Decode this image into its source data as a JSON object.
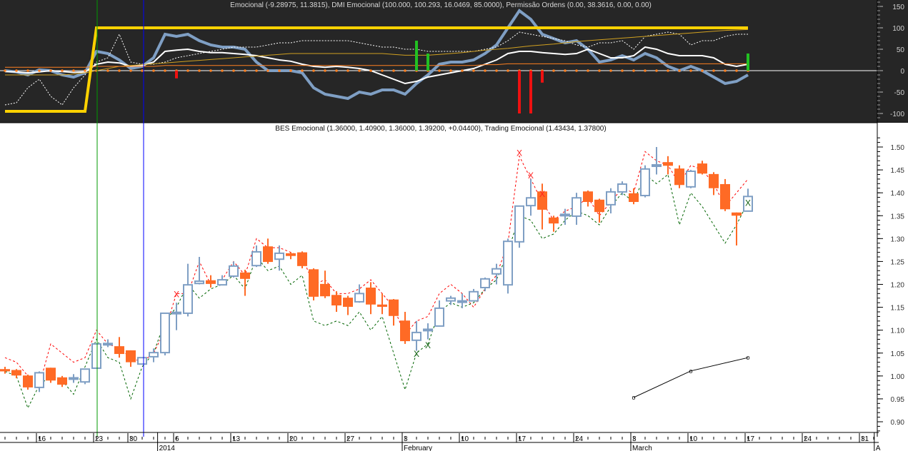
{
  "indicator_panel": {
    "title": "Emocional (-9.28975, 11.3815), DMI Emocional (100.000, 100.293, 16.0469, 85.0000), Permissão Ordens (0.00, 38.3616, 0.00, 0.00)",
    "background": "#262626",
    "y_ticks": [
      150,
      100,
      50,
      0,
      -50,
      -100
    ]
  },
  "price_panel": {
    "title": "BES Emocional (1.36000, 1.40900, 1.36000, 1.39200, +0.04400), Trading Emocional (1.43434, 1.37800)",
    "y_ticks": [
      "1.50",
      "1.45",
      "1.40",
      "1.35",
      "1.30",
      "1.25",
      "1.20",
      "1.15",
      "1.10",
      "1.05",
      "1.00",
      "0.95",
      "0.90"
    ]
  },
  "date_axis": {
    "day_labels": [
      {
        "label": "16",
        "i": 3
      },
      {
        "label": "23",
        "i": 8
      },
      {
        "label": "30",
        "i": 11
      },
      {
        "label": "6",
        "i": 15
      },
      {
        "label": "13",
        "i": 20
      },
      {
        "label": "20",
        "i": 25
      },
      {
        "label": "27",
        "i": 30
      },
      {
        "label": "3",
        "i": 35
      },
      {
        "label": "10",
        "i": 40
      },
      {
        "label": "17",
        "i": 45
      },
      {
        "label": "24",
        "i": 50
      },
      {
        "label": "3",
        "i": 55
      },
      {
        "label": "10",
        "i": 60
      },
      {
        "label": "17",
        "i": 65
      },
      {
        "label": "24",
        "i": 70
      },
      {
        "label": "31",
        "i": 75
      }
    ],
    "period_labels": [
      {
        "label": "2014",
        "i": 13.6
      },
      {
        "label": "February",
        "i": 35
      },
      {
        "label": "March",
        "i": 55
      },
      {
        "label": "A",
        "i": 76.3
      }
    ]
  },
  "colors": {
    "up": "#7f9fc4",
    "down": "#ff6a25",
    "upper_band": "#ff0000",
    "lower_band": "#006400",
    "yellow": "#ffd200",
    "emocional": "#7f9fc4",
    "buy_bar": "#22c022",
    "sell_bar": "#ee1111",
    "vline_green": "#009900",
    "vline_blue": "#0000ff"
  },
  "chart_data": [
    {
      "type": "line",
      "title": "Emocional / DMI Emocional / Permissão Ordens",
      "ylim": [
        -120,
        165
      ],
      "series": [
        {
          "name": "Emocional",
          "values": [
            0,
            -3,
            -10,
            2,
            0,
            -10,
            -15,
            -5,
            45,
            40,
            25,
            5,
            10,
            30,
            85,
            80,
            85,
            70,
            60,
            55,
            55,
            50,
            20,
            0,
            0,
            0,
            -5,
            -40,
            -55,
            -60,
            -65,
            -50,
            -55,
            -45,
            -45,
            -55,
            -30,
            -10,
            15,
            20,
            20,
            25,
            40,
            60,
            100,
            140,
            120,
            85,
            75,
            65,
            70,
            50,
            20,
            25,
            35,
            25,
            40,
            30,
            10,
            0,
            10,
            0,
            -15,
            -30,
            -25,
            -10
          ]
        },
        {
          "name": "DMI",
          "values": [
            -2,
            -3,
            -5,
            -3,
            0,
            -2,
            -4,
            -3,
            15,
            20,
            18,
            10,
            12,
            20,
            45,
            48,
            50,
            45,
            42,
            42,
            40,
            38,
            35,
            30,
            25,
            22,
            15,
            10,
            8,
            10,
            8,
            5,
            0,
            -10,
            -20,
            -30,
            -25,
            -15,
            -10,
            -5,
            0,
            5,
            15,
            25,
            40,
            45,
            45,
            42,
            40,
            38,
            40,
            50,
            40,
            30,
            30,
            35,
            55,
            50,
            40,
            35,
            35,
            35,
            30,
            15,
            10,
            15
          ]
        },
        {
          "name": "DMI dashed",
          "values": [
            -80,
            -75,
            -40,
            -20,
            -60,
            -80,
            -40,
            -10,
            20,
            30,
            85,
            20,
            15,
            15,
            20,
            30,
            35,
            40,
            45,
            50,
            55,
            55,
            55,
            60,
            65,
            65,
            70,
            70,
            70,
            70,
            70,
            65,
            60,
            55,
            55,
            50,
            50,
            45,
            45,
            45,
            45,
            45,
            50,
            55,
            70,
            90,
            85,
            80,
            75,
            70,
            60,
            55,
            65,
            65,
            70,
            50,
            80,
            85,
            90,
            85,
            60,
            70,
            70,
            80,
            85,
            85
          ]
        },
        {
          "name": "DMI trend",
          "values": [
            -10,
            -10,
            -10,
            -10,
            -10,
            -10,
            -8,
            -5,
            0,
            5,
            10,
            12,
            14,
            16,
            18,
            20,
            22,
            24,
            26,
            28,
            30,
            32,
            34,
            36,
            38,
            40,
            40,
            40,
            40,
            40,
            40,
            40,
            40,
            40,
            38,
            36,
            36,
            36,
            38,
            40,
            42,
            45,
            48,
            50,
            52,
            55,
            58,
            60,
            62,
            65,
            68,
            70,
            72,
            74,
            76,
            78,
            80,
            82,
            84,
            86,
            88,
            90,
            92,
            94,
            95,
            96
          ]
        },
        {
          "name": "Permissão",
          "values": [
            8,
            8,
            8,
            8,
            8,
            8,
            8,
            8,
            10,
            10,
            10,
            10,
            10,
            10,
            12,
            12,
            12,
            12,
            12,
            12,
            12,
            12,
            12,
            12,
            12,
            12,
            12,
            12,
            12,
            12,
            12,
            12,
            12,
            12,
            12,
            12,
            12,
            12,
            12,
            12,
            12,
            12,
            14,
            14,
            16,
            16,
            16,
            16,
            16,
            16,
            16,
            16,
            16,
            16,
            16,
            16,
            16,
            16,
            16,
            16,
            16,
            16,
            16,
            16,
            16,
            16
          ]
        },
        {
          "name": "Regime",
          "values": [
            -95,
            -95,
            -95,
            -95,
            -95,
            -95,
            -95,
            -95,
            100,
            100,
            100,
            100,
            100,
            100,
            100,
            100,
            100,
            100,
            100,
            100,
            100,
            100,
            100,
            100,
            100,
            100,
            100,
            100,
            100,
            100,
            100,
            100,
            100,
            100,
            100,
            100,
            100,
            100,
            100,
            100,
            100,
            100,
            100,
            100,
            100,
            100,
            100,
            100,
            100,
            100,
            100,
            100,
            100,
            100,
            100,
            100,
            100,
            100,
            100,
            100,
            100,
            100,
            100,
            100,
            100,
            100
          ]
        }
      ],
      "bars": [
        {
          "i": 15,
          "value": -18
        },
        {
          "i": 36,
          "value": 70
        },
        {
          "i": 37,
          "value": 40
        },
        {
          "i": 45,
          "value": -100
        },
        {
          "i": 46,
          "value": -100
        },
        {
          "i": 47,
          "value": -28
        },
        {
          "i": 65,
          "value": 40
        }
      ]
    },
    {
      "type": "candlestick",
      "title": "BES Emocional",
      "ylim": [
        0.88,
        1.54
      ],
      "ohlc": [
        [
          1.015,
          1.02,
          1.005,
          1.01
        ],
        [
          1.013,
          1.015,
          0.995,
          1.001
        ],
        [
          1.001,
          1.003,
          0.97,
          0.975
        ],
        [
          0.975,
          1.01,
          0.965,
          1.007
        ],
        [
          1.018,
          1.018,
          0.985,
          0.99
        ],
        [
          0.997,
          1.0,
          0.976,
          0.981
        ],
        [
          0.995,
          1.004,
          0.985,
          0.996
        ],
        [
          0.987,
          1.015,
          0.982,
          1.015
        ],
        [
          1.017,
          1.07,
          1.017,
          1.07
        ],
        [
          1.07,
          1.08,
          1.063,
          1.071
        ],
        [
          1.065,
          1.085,
          1.04,
          1.048
        ],
        [
          1.056,
          1.056,
          1.02,
          1.03
        ],
        [
          1.026,
          1.04,
          1.026,
          1.04
        ],
        [
          1.042,
          1.06,
          1.03,
          1.051
        ],
        [
          1.051,
          1.137,
          1.045,
          1.137
        ],
        [
          1.138,
          1.16,
          1.1,
          1.139
        ],
        [
          1.137,
          1.245,
          1.13,
          1.199
        ],
        [
          1.202,
          1.26,
          1.2,
          1.207
        ],
        [
          1.209,
          1.22,
          1.193,
          1.201
        ],
        [
          1.199,
          1.22,
          1.199,
          1.21
        ],
        [
          1.218,
          1.25,
          1.215,
          1.24
        ],
        [
          1.226,
          1.232,
          1.175,
          1.212
        ],
        [
          1.241,
          1.285,
          1.238,
          1.271
        ],
        [
          1.283,
          1.3,
          1.245,
          1.249
        ],
        [
          1.255,
          1.285,
          1.23,
          1.268
        ],
        [
          1.268,
          1.27,
          1.255,
          1.262
        ],
        [
          1.27,
          1.272,
          1.235,
          1.24
        ],
        [
          1.233,
          1.235,
          1.165,
          1.173
        ],
        [
          1.201,
          1.23,
          1.17,
          1.174
        ],
        [
          1.177,
          1.185,
          1.14,
          1.154
        ],
        [
          1.171,
          1.175,
          1.133,
          1.151
        ],
        [
          1.162,
          1.2,
          1.16,
          1.18
        ],
        [
          1.193,
          1.205,
          1.135,
          1.156
        ],
        [
          1.156,
          1.18,
          1.135,
          1.151
        ],
        [
          1.167,
          1.168,
          1.11,
          1.131
        ],
        [
          1.121,
          1.14,
          1.07,
          1.076
        ],
        [
          1.078,
          1.12,
          1.055,
          1.095
        ],
        [
          1.099,
          1.115,
          1.08,
          1.102
        ],
        [
          1.109,
          1.165,
          1.108,
          1.148
        ],
        [
          1.164,
          1.175,
          1.155,
          1.17
        ],
        [
          1.164,
          1.18,
          1.148,
          1.164
        ],
        [
          1.164,
          1.19,
          1.164,
          1.184
        ],
        [
          1.193,
          1.215,
          1.185,
          1.212
        ],
        [
          1.223,
          1.245,
          1.2,
          1.234
        ],
        [
          1.199,
          1.3,
          1.18,
          1.294
        ],
        [
          1.293,
          1.372,
          1.28,
          1.371
        ],
        [
          1.372,
          1.43,
          1.35,
          1.389
        ],
        [
          1.403,
          1.42,
          1.32,
          1.363
        ],
        [
          1.346,
          1.35,
          1.315,
          1.333
        ],
        [
          1.352,
          1.365,
          1.33,
          1.353
        ],
        [
          1.349,
          1.4,
          1.33,
          1.389
        ],
        [
          1.403,
          1.405,
          1.37,
          1.38
        ],
        [
          1.385,
          1.387,
          1.335,
          1.358
        ],
        [
          1.374,
          1.41,
          1.355,
          1.402
        ],
        [
          1.402,
          1.425,
          1.395,
          1.419
        ],
        [
          1.399,
          1.41,
          1.375,
          1.38
        ],
        [
          1.394,
          1.46,
          1.39,
          1.452
        ],
        [
          1.458,
          1.5,
          1.44,
          1.461
        ],
        [
          1.467,
          1.48,
          1.44,
          1.459
        ],
        [
          1.453,
          1.46,
          1.41,
          1.417
        ],
        [
          1.413,
          1.45,
          1.41,
          1.447
        ],
        [
          1.464,
          1.47,
          1.44,
          1.442
        ],
        [
          1.441,
          1.445,
          1.395,
          1.41
        ],
        [
          1.419,
          1.43,
          1.36,
          1.364
        ],
        [
          1.357,
          1.357,
          1.285,
          1.35
        ],
        [
          1.36,
          1.409,
          1.36,
          1.392
        ]
      ],
      "upper_band": [
        1.04,
        1.03,
        1.0,
        0.98,
        1.07,
        1.05,
        1.03,
        1.04,
        1.1,
        1.07,
        1.06,
        1.04,
        1.03,
        1.05,
        1.1,
        1.18,
        1.18,
        1.25,
        1.2,
        1.21,
        1.25,
        1.22,
        1.3,
        1.28,
        1.28,
        1.27,
        1.26,
        1.2,
        1.21,
        1.18,
        1.18,
        1.19,
        1.21,
        1.18,
        1.15,
        1.09,
        1.12,
        1.13,
        1.18,
        1.2,
        1.18,
        1.15,
        1.19,
        1.22,
        1.29,
        1.48,
        1.43,
        1.38,
        1.34,
        1.36,
        1.37,
        1.39,
        1.35,
        1.38,
        1.41,
        1.4,
        1.49,
        1.47,
        1.46,
        1.42,
        1.46,
        1.45,
        1.42,
        1.37,
        1.4,
        1.43
      ],
      "lower_band": [
        1.01,
        1.0,
        0.93,
        0.98,
        1.0,
        0.99,
        0.96,
        1.02,
        1.08,
        1.04,
        1.03,
        0.95,
        1.02,
        1.05,
        1.12,
        1.15,
        1.2,
        1.17,
        1.19,
        1.2,
        1.22,
        1.19,
        1.26,
        1.23,
        1.24,
        1.2,
        1.22,
        1.12,
        1.11,
        1.12,
        1.11,
        1.14,
        1.1,
        1.13,
        1.05,
        0.97,
        1.05,
        1.07,
        1.14,
        1.16,
        1.15,
        1.16,
        1.19,
        1.21,
        1.27,
        1.35,
        1.34,
        1.3,
        1.31,
        1.34,
        1.36,
        1.35,
        1.33,
        1.37,
        1.4,
        1.38,
        1.44,
        1.42,
        1.44,
        1.33,
        1.4,
        1.37,
        1.33,
        1.29,
        1.33,
        1.38
      ],
      "sell_signals": [
        {
          "i": 15,
          "price": 1.178
        },
        {
          "i": 45,
          "price": 1.487
        },
        {
          "i": 46,
          "price": 1.438
        },
        {
          "i": 47,
          "price": 1.397
        }
      ],
      "buy_signals": [
        {
          "i": 36,
          "price": 1.048
        },
        {
          "i": 37,
          "price": 1.067
        },
        {
          "i": 65,
          "price": 1.378
        }
      ],
      "signal_marker": "X",
      "trendline": [
        {
          "i": 55,
          "price": 0.953
        },
        {
          "i": 60,
          "price": 1.011
        },
        {
          "i": 65,
          "price": 1.04
        }
      ],
      "trendline_marker": "o",
      "vertical_markers": [
        {
          "i": 8,
          "color": "green"
        },
        {
          "i": 12,
          "color": "blue"
        }
      ]
    }
  ]
}
